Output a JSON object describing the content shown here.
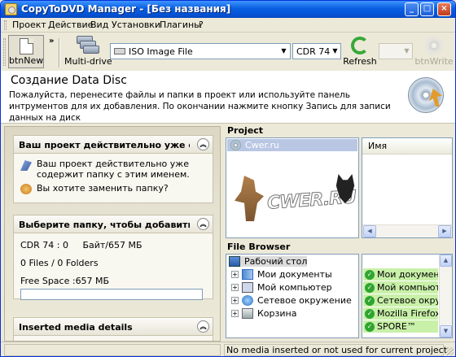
{
  "window": {
    "title": "CopyToDVD Manager - [Без названия]",
    "accent": "#0453d6"
  },
  "menu": [
    "Проект",
    "Действие",
    "Вид",
    "Установки",
    "Плагины",
    "?"
  ],
  "toolbar": {
    "new_label": "btnNew",
    "more_label": "»",
    "multidrive_label": "Multi-drive",
    "image_type": "ISO Image File",
    "capacity": "CDR 74",
    "refresh_label": "Refresh",
    "write_label": "btnWrite"
  },
  "header": {
    "title": "Создание Data Disc",
    "description": "Пожалуйста, перенесите файлы и папки в проект или используйте панель интрументов для их добавления. По окончании нажмите кнопку Запись для записи данных на диск"
  },
  "left": {
    "warning": {
      "title": "Ваш проект действительно уже содерж",
      "message": "Ваш проект действительно уже содержит папку с этим именем.",
      "question": "Вы хотите заменить папку?"
    },
    "select_folder": {
      "title": "Выберите папку, чтобы добавить",
      "capacity_line": "CDR 74 : 0     Байт/657 МБ",
      "files_line": "0 Files / 0 Folders",
      "free_space": "Free Space :657 МБ",
      "progress": 0
    },
    "media": {
      "title": "Inserted media details"
    }
  },
  "project": {
    "title": "Project",
    "root": "Cwer.ru",
    "column_name": "Имя",
    "watermark": "CWER.RU"
  },
  "browser": {
    "title": "File Browser",
    "tree": [
      "Рабочий стол",
      "Мои документы",
      "Мой компьютер",
      "Сетевое окружение",
      "Корзина"
    ],
    "list": [
      "Мои документы",
      "Мой компьютер",
      "Сетевое окружение",
      "Mozilla Firefox",
      "SPORE™"
    ],
    "list_highlight": "#c8f0a8"
  },
  "status": {
    "left": "",
    "right": "No media inserted or not used for current project"
  }
}
